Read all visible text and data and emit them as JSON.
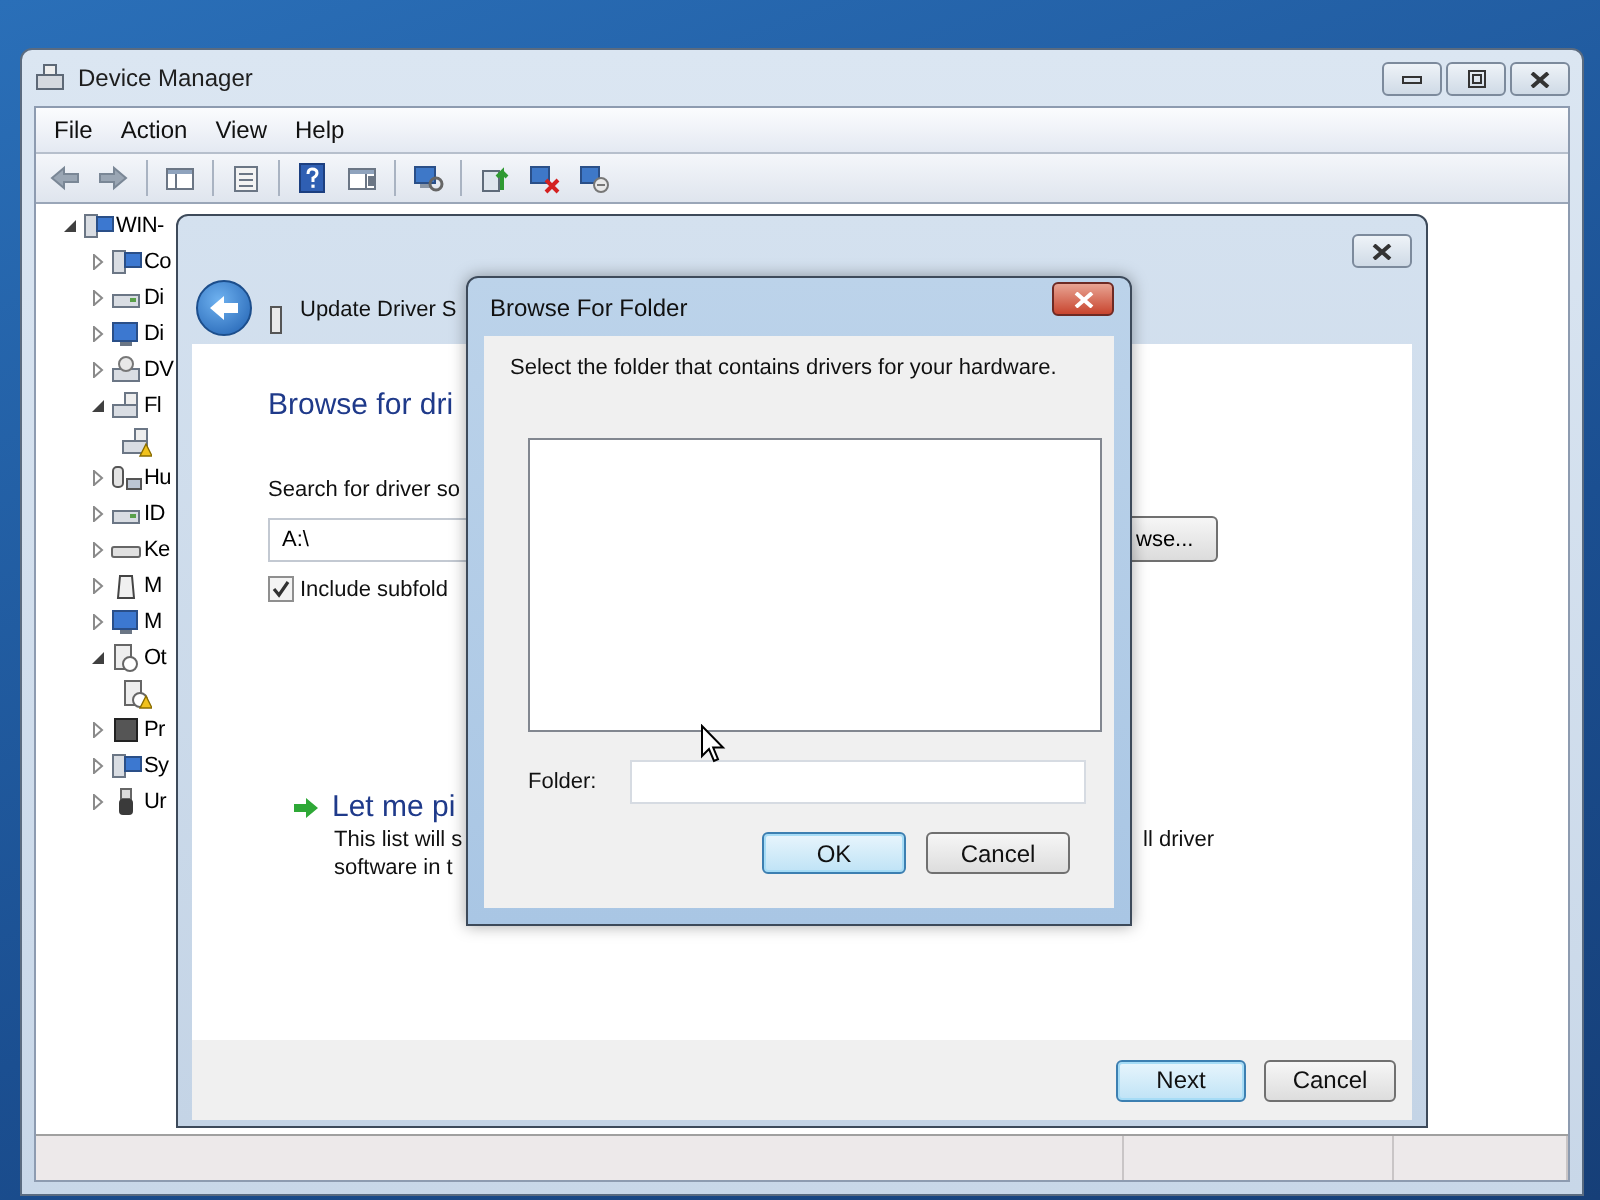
{
  "window": {
    "title": "Device Manager",
    "menu": [
      "File",
      "Action",
      "View",
      "Help"
    ]
  },
  "toolbar": [
    {
      "kind": "back"
    },
    {
      "kind": "forward"
    },
    {
      "kind": "separator"
    },
    {
      "kind": "tree-pane"
    },
    {
      "kind": "separator"
    },
    {
      "kind": "properties"
    },
    {
      "kind": "separator"
    },
    {
      "kind": "help"
    },
    {
      "kind": "action-pane"
    },
    {
      "kind": "separator"
    },
    {
      "kind": "scan"
    },
    {
      "kind": "separator"
    },
    {
      "kind": "update"
    },
    {
      "kind": "uninstall"
    },
    {
      "kind": "disable"
    }
  ],
  "tree": {
    "label": "WIN-",
    "kind": "computer",
    "expanded": true,
    "warning": false,
    "children": [
      {
        "label": "Co",
        "kind": "computer",
        "expanded": false,
        "warning": false
      },
      {
        "label": "Di",
        "kind": "disk",
        "expanded": false,
        "warning": false
      },
      {
        "label": "Di",
        "kind": "monitor",
        "expanded": false,
        "warning": false
      },
      {
        "label": "DV",
        "kind": "dvd",
        "expanded": false,
        "warning": false
      },
      {
        "label": "Fl",
        "kind": "floppy",
        "expanded": true,
        "warning": false,
        "children": [
          {
            "kind": "floppy",
            "warning": true
          }
        ]
      },
      {
        "label": "Hu",
        "kind": "hid",
        "expanded": false,
        "warning": false
      },
      {
        "label": "ID",
        "kind": "disk",
        "expanded": false,
        "warning": false
      },
      {
        "label": "Ke",
        "kind": "keyboard",
        "expanded": false,
        "warning": false
      },
      {
        "label": "M",
        "kind": "mouse",
        "expanded": false,
        "warning": false
      },
      {
        "label": "M",
        "kind": "monitor",
        "expanded": false,
        "warning": false
      },
      {
        "label": "Ot",
        "kind": "other",
        "expanded": true,
        "warning": false,
        "children": [
          {
            "kind": "other",
            "warning": true
          }
        ]
      },
      {
        "label": "Pr",
        "kind": "processor",
        "expanded": false,
        "warning": false
      },
      {
        "label": "Sy",
        "kind": "computer",
        "expanded": false,
        "warning": false
      },
      {
        "label": "Ur",
        "kind": "usb",
        "expanded": false,
        "warning": false
      }
    ]
  },
  "wizard": {
    "title": "Update Driver S",
    "heading": "Browse for dri",
    "search_label": "Search for driver so",
    "path": "A:\\",
    "browse_button": "wse...",
    "include_subfolders": {
      "label": "Include subfold",
      "checked": true
    },
    "option": {
      "title": "Let me pi",
      "line_1": "This list will s",
      "line_1_tail": "ll driver",
      "line_2": "software in t"
    },
    "buttons": [
      {
        "label": "Next",
        "default": true
      },
      {
        "label": "Cancel",
        "default": false
      }
    ]
  },
  "dialog": {
    "title": "Browse For Folder",
    "prompt": "Select the folder that contains drivers for your hardware.",
    "folder_label": "Folder:",
    "buttons": [
      {
        "label": "OK",
        "default": true
      },
      {
        "label": "Cancel",
        "default": false
      }
    ]
  }
}
